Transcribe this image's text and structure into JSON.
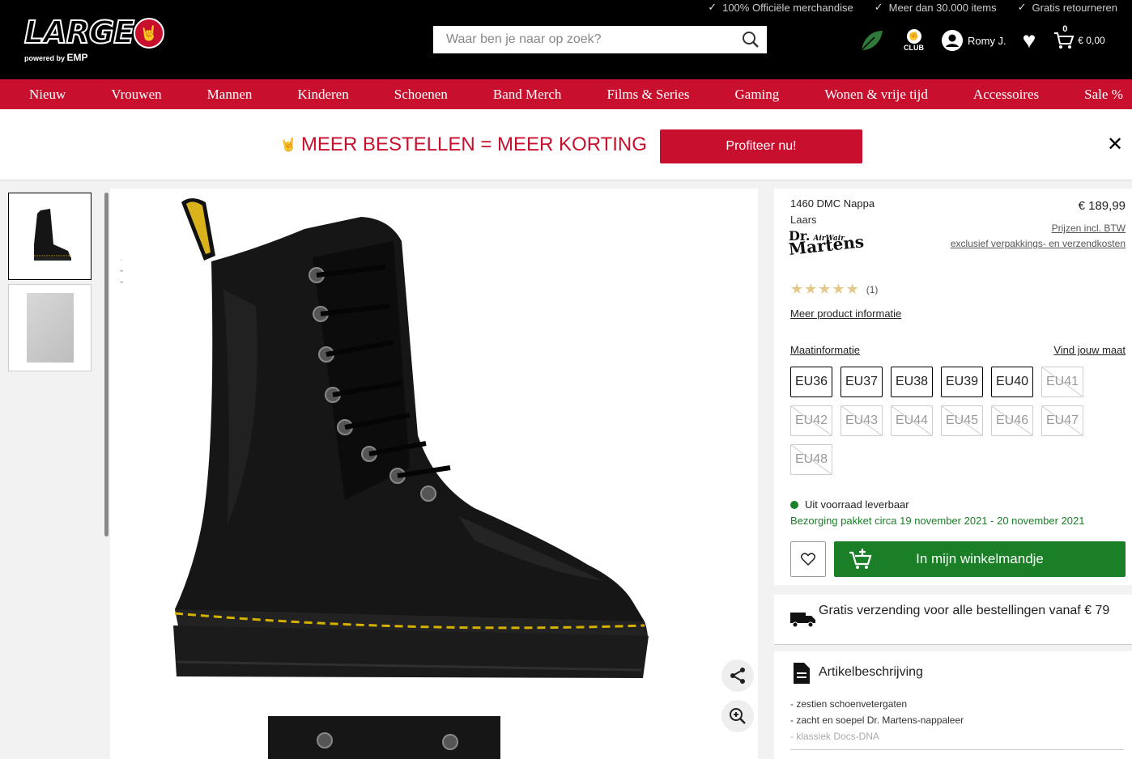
{
  "usp": [
    "100% Officiële merchandise",
    "Meer dan 30.000 items",
    "Gratis retourneren"
  ],
  "logo": {
    "text": "LARGE",
    "sub": "powered by",
    "sub_brand": "EMP"
  },
  "search": {
    "placeholder": "Waar ben je naar op zoek?"
  },
  "header": {
    "club_label": "CLUB",
    "user_name": "Romy J.",
    "cart_count": "0",
    "cart_total": "€ 0,00"
  },
  "nav": [
    "Nieuw",
    "Vrouwen",
    "Mannen",
    "Kinderen",
    "Schoenen",
    "Band Merch",
    "Films & Series",
    "Gaming",
    "Wonen & vrije tijd",
    "Accessoires",
    "Sale %"
  ],
  "promo": {
    "text": "MEER BESTELLEN = MEER KORTING",
    "button": "Profiteer nu!"
  },
  "product": {
    "name": "1460 DMC Nappa",
    "type": "Laars",
    "brand_line1": "Dr.",
    "brand_air": "AirWair",
    "brand_line2": "Martens",
    "price": "€ 189,99",
    "price_note1": "Prijzen incl. BTW",
    "price_note2": "exclusief verpakkings- en verzendkosten",
    "rating": 5,
    "rating_count": "(1)",
    "more_info": "Meer product informatie",
    "size_info": "Maatinformatie",
    "find_size": "Vind jouw maat",
    "sizes": [
      {
        "label": "EU36",
        "available": true
      },
      {
        "label": "EU37",
        "available": true
      },
      {
        "label": "EU38",
        "available": true
      },
      {
        "label": "EU39",
        "available": true
      },
      {
        "label": "EU40",
        "available": true
      },
      {
        "label": "EU41",
        "available": false
      },
      {
        "label": "EU42",
        "available": false
      },
      {
        "label": "EU43",
        "available": false
      },
      {
        "label": "EU44",
        "available": false
      },
      {
        "label": "EU45",
        "available": false
      },
      {
        "label": "EU46",
        "available": false
      },
      {
        "label": "EU47",
        "available": false
      },
      {
        "label": "EU48",
        "available": false
      }
    ],
    "stock": "Uit voorraad leverbaar",
    "delivery": "Bezorging pakket circa 19 november 2021 - 20 november 2021",
    "cart_button": "In mijn winkelmandje"
  },
  "shipping": {
    "text": "Gratis verzending voor alle bestellingen vanaf € 79"
  },
  "description": {
    "title": "Artikelbeschrijving",
    "items": [
      "- zestien schoenvetergaten",
      "- zacht en soepel Dr. Martens-nappaleer",
      "- klassiek Docs-DNA"
    ]
  },
  "colors": {
    "brand_red": "#c8102e",
    "green": "#1a7f27",
    "black": "#000000"
  }
}
